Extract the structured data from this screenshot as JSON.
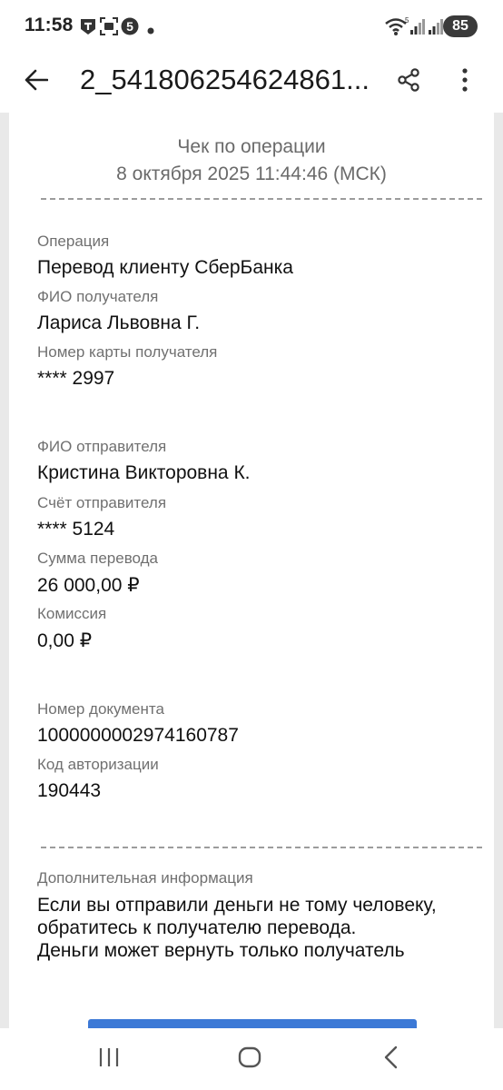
{
  "status_bar": {
    "time": "11:58",
    "battery": "85",
    "icons": [
      "notification-t-icon",
      "screen-icon",
      "five-badge-icon",
      "dot-icon",
      "wifi-icon",
      "signal-icon",
      "signal-icon-2"
    ]
  },
  "app_bar": {
    "title": "2_541806254624861...",
    "back_icon": "arrow-left-icon",
    "share_icon": "share-icon",
    "menu_icon": "more-vert-icon"
  },
  "receipt": {
    "title": "Чек по операции",
    "date": "8 октября 2025 11:44:46 (МСК)",
    "fields": [
      {
        "label": "Операция",
        "value": "Перевод клиенту СберБанка"
      },
      {
        "label": "ФИО получателя",
        "value": "Лариса Львовна Г."
      },
      {
        "label": "Номер карты получателя",
        "value": "**** 2997"
      },
      {
        "label": "ФИО отправителя",
        "value": "Кристина Викторовна К."
      },
      {
        "label": "Счёт отправителя",
        "value": "**** 5124"
      },
      {
        "label": "Сумма перевода",
        "value": "26 000,00 ₽"
      },
      {
        "label": "Комиссия",
        "value": "0,00 ₽"
      },
      {
        "label": "Номер документа",
        "value": "1000000002974160787"
      },
      {
        "label": "Код авторизации",
        "value": "190443"
      }
    ],
    "additional_label": "Дополнительная информация",
    "additional_lines": [
      "Если вы отправили деньги не тому человеку,",
      "обратитесь к получателю перевода.",
      "Деньги может вернуть только получатель"
    ]
  },
  "nav_bar": {
    "recents_icon": "recents-icon",
    "home_icon": "home-icon",
    "back_icon": "nav-back-icon"
  },
  "colors": {
    "button_blue": "#3c79d6",
    "label_gray": "#707070",
    "background_gray": "#e9e9e9"
  }
}
